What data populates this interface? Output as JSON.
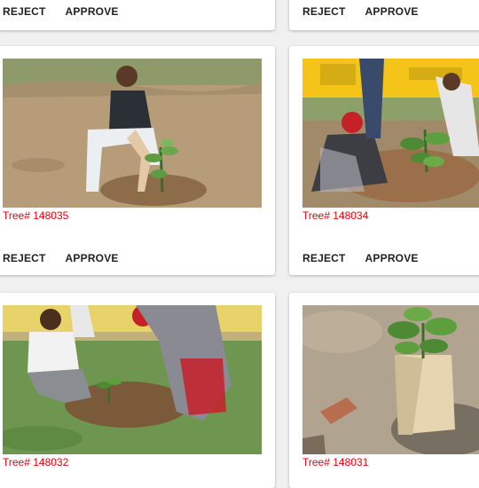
{
  "actions": {
    "reject_label": "REJECT",
    "approve_label": "APPROVE"
  },
  "cards": [
    {
      "tree_id": "Tree# 148035"
    },
    {
      "tree_id": "Tree# 148034"
    },
    {
      "tree_id": "Tree# 148032"
    },
    {
      "tree_id": "Tree# 148031"
    }
  ],
  "colors": {
    "tree_id": "#e8000b",
    "background": "#f0f0f0"
  }
}
